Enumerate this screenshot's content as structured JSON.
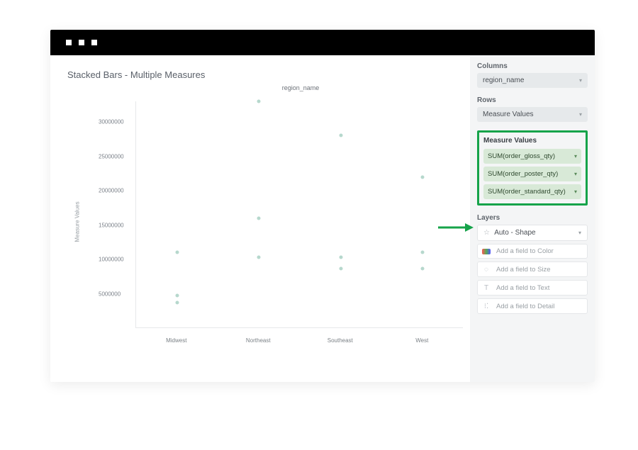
{
  "chart": {
    "title": "Stacked Bars - Multiple Measures",
    "subtitle": "region_name",
    "yaxis_label": "Measure Values"
  },
  "chart_data": {
    "type": "scatter",
    "title": "Stacked Bars - Multiple Measures",
    "xlabel": "region_name",
    "ylabel": "Measure Values",
    "ylim": [
      0,
      33000000
    ],
    "yticks": [
      5000000,
      10000000,
      15000000,
      20000000,
      25000000,
      30000000
    ],
    "categories": [
      "Midwest",
      "Northeast",
      "Southeast",
      "West"
    ],
    "series": [
      {
        "name": "SUM(order_gloss_qty)",
        "values": [
          11000000,
          33000000,
          28000000,
          22000000
        ]
      },
      {
        "name": "SUM(order_poster_qty)",
        "values": [
          4700000,
          16000000,
          10300000,
          11000000
        ]
      },
      {
        "name": "SUM(order_standard_qty)",
        "values": [
          3700000,
          10300000,
          8700000,
          8700000
        ]
      }
    ]
  },
  "side": {
    "columns_label": "Columns",
    "columns_pill": "region_name",
    "rows_label": "Rows",
    "rows_pill": "Measure Values",
    "measure_values_label": "Measure Values",
    "mv_items": [
      "SUM(order_gloss_qty)",
      "SUM(order_poster_qty)",
      "SUM(order_standard_qty)"
    ],
    "layers_label": "Layers",
    "layers_pill": "Auto - Shape",
    "layer_placeholders": {
      "color": "Add a field to Color",
      "size": "Add a field to Size",
      "text": "Add a field to Text",
      "detail": "Add a field to Detail"
    }
  }
}
